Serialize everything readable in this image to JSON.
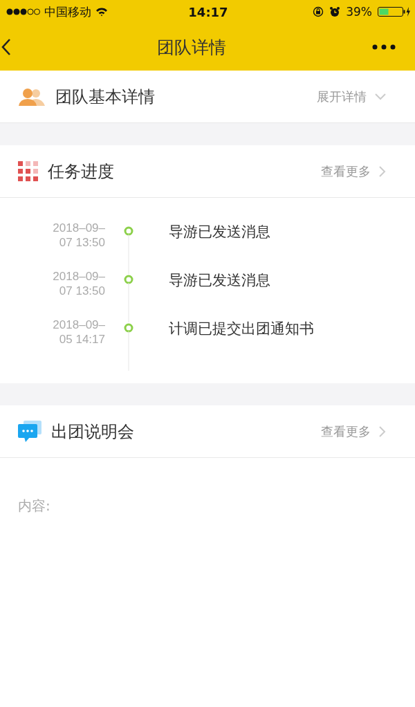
{
  "status_bar": {
    "carrier": "中国移动",
    "time": "14:17",
    "battery_percent": "39%"
  },
  "nav_bar": {
    "title": "团队详情"
  },
  "team_section": {
    "title": "团队基本详情",
    "action": "展开详情"
  },
  "tasks_section": {
    "title": "任务进度",
    "action": "查看更多",
    "timeline": [
      {
        "time": "2018–09–07 13:50",
        "text": "导游已发送消息"
      },
      {
        "time": "2018–09–07 13:50",
        "text": "导游已发送消息"
      },
      {
        "time": "2018–09–05 14:17",
        "text": "计调已提交出团通知书"
      }
    ]
  },
  "briefing_section": {
    "title": "出团说明会",
    "action": "查看更多",
    "content_label": "内容:"
  }
}
